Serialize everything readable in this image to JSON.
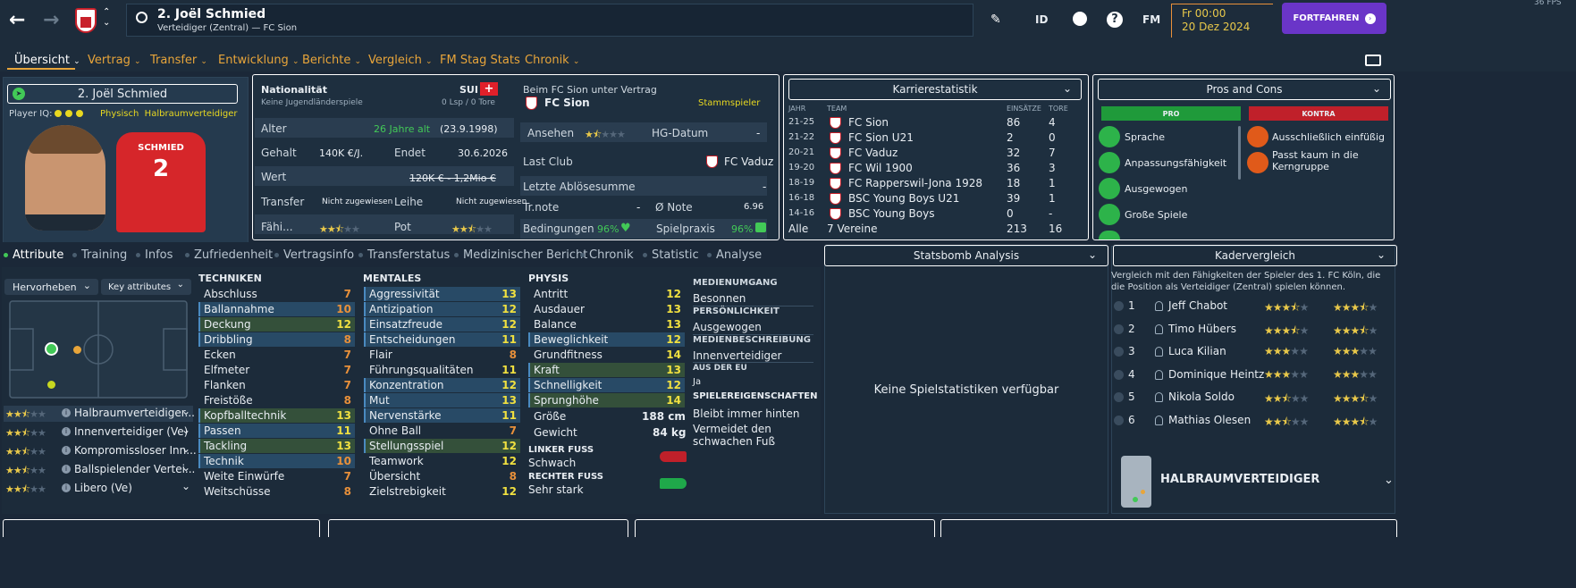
{
  "header": {
    "title": "2. Joël Schmied",
    "subtitle": "Verteidiger (Zentral) — FC Sion",
    "id_label": "ID",
    "fm_label": "FM",
    "date_time": "Fr 00:00",
    "date": "20 Dez 2024",
    "continue_label": "FORTFAHREN",
    "fps": "36 FPS"
  },
  "nav": {
    "tabs": [
      "Übersicht",
      "Vertrag",
      "Transfer",
      "Entwicklung",
      "Berichte",
      "Vergleich",
      "FM Stag Stats",
      "Chronik"
    ]
  },
  "player_card": {
    "name": "2. Joël Schmied",
    "player_iq_label": "Player IQ:",
    "iq_tags": "Physisch  Halbraumverteidiger",
    "shirt_name": "SCHMIED",
    "shirt_number": "2"
  },
  "info": {
    "nationality_label": "Nationalität",
    "nationality_value": "SUI",
    "youth_label": "Keine Jugendländerspiele",
    "caps": "0 Lsp / 0 Tore",
    "age_label": "Alter",
    "age_value": "26 Jahre alt",
    "birth": "(23.9.1998)",
    "salary_label": "Gehalt",
    "salary_value": "140K €/J.",
    "ends_label": "Endet",
    "ends_value": "30.6.2026",
    "value_label": "Wert",
    "value_value": "120K € - 1,2Mio €",
    "transfer_label": "Transfer",
    "transfer_value": "Nicht zugewiesen",
    "loan_label": "Leihe",
    "loan_value": "Nicht zugewiesen",
    "ability_label": "Fähi...",
    "ability_stars": 2.5,
    "pot_label": "Pot",
    "pot_stars": 2.5,
    "contract_label": "Beim FC Sion unter Vertrag",
    "club": "FC Sion",
    "role": "Stammspieler",
    "reputation_label": "Ansehen",
    "reputation_stars": 1.5,
    "hg_label": "HG-Datum",
    "hg_value": "-",
    "last_club_label": "Last Club",
    "last_club_value": "FC Vaduz",
    "last_fee_label": "Letzte Ablösesumme",
    "last_fee_value": "-",
    "trnote_label": "Tr.note",
    "trnote_value": "-",
    "avgnote_label": "Ø Note",
    "avgnote_value": "6.96",
    "conditions_label": "Bedingungen",
    "conditions_value": "96%",
    "match_practice_label": "Spielpraxis",
    "match_practice_value": "96%"
  },
  "career": {
    "title": "Karrierestatistik",
    "headers": [
      "JAHR",
      "TEAM",
      "EINSÄTZE",
      "TORE"
    ],
    "rows": [
      {
        "year": "21-25",
        "team": "FC Sion",
        "apps": "86",
        "goals": "4"
      },
      {
        "year": "21-22",
        "team": "FC Sion U21",
        "apps": "2",
        "goals": "0"
      },
      {
        "year": "20-21",
        "team": "FC Vaduz",
        "apps": "32",
        "goals": "7"
      },
      {
        "year": "19-20",
        "team": "FC Wil 1900",
        "apps": "36",
        "goals": "3"
      },
      {
        "year": "18-19",
        "team": "FC Rapperswil-Jona 1928",
        "apps": "18",
        "goals": "1"
      },
      {
        "year": "16-18",
        "team": "BSC Young Boys U21",
        "apps": "39",
        "goals": "1"
      },
      {
        "year": "14-16",
        "team": "BSC Young Boys",
        "apps": "0",
        "goals": "-"
      }
    ],
    "total": {
      "year": "Alle",
      "team": "7 Vereine",
      "apps": "213",
      "goals": "16"
    }
  },
  "pros_cons": {
    "title": "Pros and Cons",
    "pro_label": "PRO",
    "contra_label": "KONTRA",
    "pros": [
      "Sprache",
      "Anpassungsfähigkeit",
      "Ausgewogen",
      "Große Spiele"
    ],
    "cons": [
      "Ausschließlich einfüßig",
      "Passt kaum in die Kerngruppe"
    ]
  },
  "subtabs": [
    "Attribute",
    "Training",
    "Infos",
    "Zufriedenheit",
    "Vertragsinfo",
    "Transferstatus",
    "Medizinischer Bericht",
    "Chronik",
    "Statistic",
    "Analyse"
  ],
  "filters": {
    "highlight": "Hervorheben",
    "key_attributes": "Key attributes"
  },
  "roles": [
    {
      "name": "Halbraumverteidiger...",
      "stars": 2.5
    },
    {
      "name": "Innenverteidiger (Ve)",
      "stars": 2.5
    },
    {
      "name": "Kompromissloser Inn...",
      "stars": 2.5
    },
    {
      "name": "Ballspielender Vertei...",
      "stars": 2.5
    },
    {
      "name": "Libero (Ve)",
      "stars": 2.5
    }
  ],
  "technical": {
    "title": "TECHNIKEN",
    "items": [
      {
        "name": "Abschluss",
        "value": "7"
      },
      {
        "name": "Ballannahme",
        "value": "10"
      },
      {
        "name": "Deckung",
        "value": "12"
      },
      {
        "name": "Dribbling",
        "value": "8"
      },
      {
        "name": "Ecken",
        "value": "7"
      },
      {
        "name": "Elfmeter",
        "value": "7"
      },
      {
        "name": "Flanken",
        "value": "7"
      },
      {
        "name": "Freistöße",
        "value": "8"
      },
      {
        "name": "Kopfballtechnik",
        "value": "13"
      },
      {
        "name": "Passen",
        "value": "11"
      },
      {
        "name": "Tackling",
        "value": "13"
      },
      {
        "name": "Technik",
        "value": "10"
      },
      {
        "name": "Weite Einwürfe",
        "value": "7"
      },
      {
        "name": "Weitschüsse",
        "value": "8"
      }
    ]
  },
  "mental": {
    "title": "MENTALES",
    "items": [
      {
        "name": "Aggressivität",
        "value": "13"
      },
      {
        "name": "Antizipation",
        "value": "12"
      },
      {
        "name": "Einsatzfreude",
        "value": "12"
      },
      {
        "name": "Entscheidungen",
        "value": "11"
      },
      {
        "name": "Flair",
        "value": "8"
      },
      {
        "name": "Führungsqualitäten",
        "value": "11"
      },
      {
        "name": "Konzentration",
        "value": "12"
      },
      {
        "name": "Mut",
        "value": "13"
      },
      {
        "name": "Nervenstärke",
        "value": "11"
      },
      {
        "name": "Ohne Ball",
        "value": "7"
      },
      {
        "name": "Stellungsspiel",
        "value": "12"
      },
      {
        "name": "Teamwork",
        "value": "12"
      },
      {
        "name": "Übersicht",
        "value": "8"
      },
      {
        "name": "Zielstrebigkeit",
        "value": "12"
      }
    ]
  },
  "physical": {
    "title": "PHYSIS",
    "items": [
      {
        "name": "Antritt",
        "value": "12"
      },
      {
        "name": "Ausdauer",
        "value": "13"
      },
      {
        "name": "Balance",
        "value": "13"
      },
      {
        "name": "Beweglichkeit",
        "value": "12"
      },
      {
        "name": "Grundfitness",
        "value": "14"
      },
      {
        "name": "Kraft",
        "value": "13"
      },
      {
        "name": "Schnelligkeit",
        "value": "12"
      },
      {
        "name": "Sprunghöhe",
        "value": "14"
      }
    ],
    "height_label": "Größe",
    "height_value": "188 cm",
    "weight_label": "Gewicht",
    "weight_value": "84 kg",
    "left_foot_label": "LINKER FUSS",
    "left_foot_value": "Schwach",
    "right_foot_label": "RECHTER FUSS",
    "right_foot_value": "Sehr stark"
  },
  "media": {
    "media_handling_label": "MEDIENUMGANG",
    "media_handling_value": "Besonnen",
    "personality_label": "PERSÖNLICHKEIT",
    "personality_value": "Ausgewogen",
    "media_desc_label": "MEDIENBESCHREIBUNG",
    "media_desc_value": "Innenverteidiger",
    "eu_label": "AUS DER EU",
    "eu_value": "Ja",
    "traits_label": "SPIELEREIGENSCHAFTEN",
    "traits": [
      "Bleibt immer hinten",
      "Vermeidet den schwachen Fuß"
    ]
  },
  "statsbomb": {
    "title": "Statsbomb Analysis",
    "empty": "Keine Spielstatistiken verfügbar"
  },
  "squad": {
    "title": "Kadervergleich",
    "desc": "Vergleich mit den Fähigkeiten der Spieler des 1. FC Köln, die die Position als Verteidiger (Zentral) spielen können.",
    "players": [
      {
        "rank": "1",
        "name": "Jeff Chabot",
        "ca": 3.5,
        "pa": 3.5
      },
      {
        "rank": "2",
        "name": "Timo Hübers",
        "ca": 3.5,
        "pa": 3.5
      },
      {
        "rank": "3",
        "name": "Luca Kilian",
        "ca": 3,
        "pa": 3
      },
      {
        "rank": "4",
        "name": "Dominique Heintz",
        "ca": 3,
        "pa": 3
      },
      {
        "rank": "5",
        "name": "Nikola Soldo",
        "ca": 2.5,
        "pa": 3.5
      },
      {
        "rank": "6",
        "name": "Mathias Olesen",
        "ca": 2.5,
        "pa": 3.5
      }
    ],
    "role_footer": "HALBRAUMVERTEIDIGER"
  },
  "colors": {
    "accent_purple": "#6a35c8",
    "pro_green": "#1f9a3a",
    "contra_red": "#c0202a",
    "gold": "#e8c84a",
    "orange": "#e8903a"
  }
}
